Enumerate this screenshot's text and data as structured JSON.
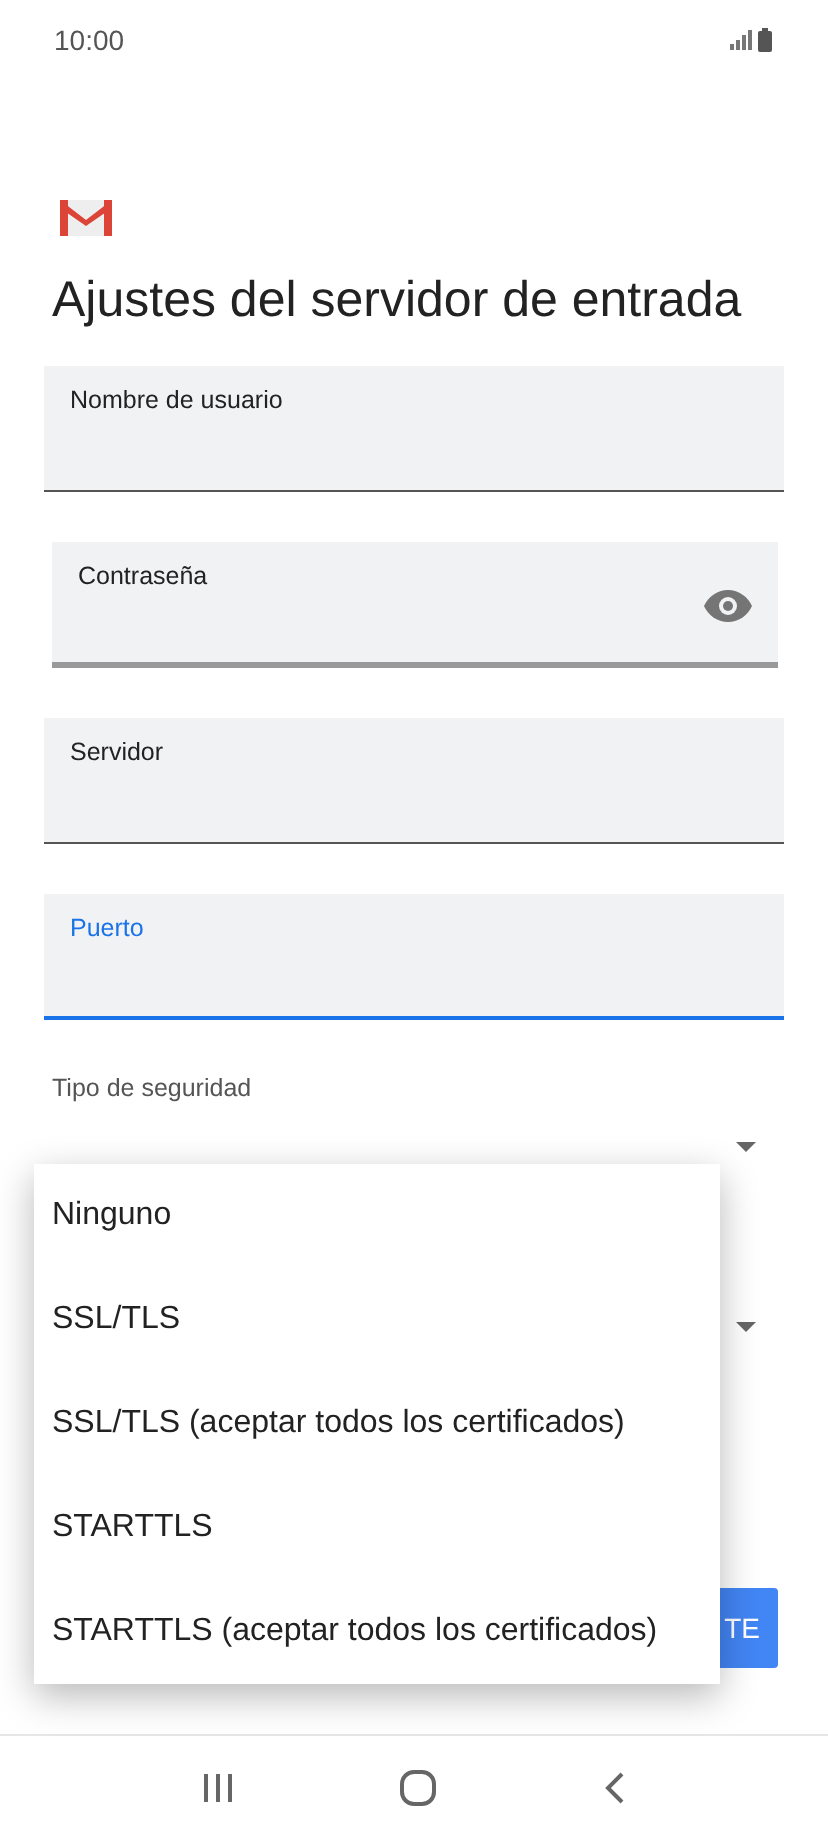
{
  "status_bar": {
    "time": "10:00"
  },
  "title": "Ajustes del servidor de entrada",
  "fields": [
    {
      "label": "Nombre de usuario",
      "kind": "text",
      "focused": false
    },
    {
      "label": "Contraseña",
      "kind": "password",
      "focused": false
    },
    {
      "label": "Servidor",
      "kind": "text",
      "focused": false
    },
    {
      "label": "Puerto",
      "kind": "text",
      "focused": true
    }
  ],
  "security": {
    "label": "Tipo de seguridad"
  },
  "menu": [
    {
      "label": "Ninguno",
      "selected": false
    },
    {
      "label": "SSL/TLS",
      "selected": false
    },
    {
      "label": "SSL/TLS (aceptar todos los certificados)",
      "selected": false
    },
    {
      "label": "STARTTLS",
      "selected": false
    },
    {
      "label": "STARTTLS (aceptar todos los certificados)",
      "selected": false
    }
  ],
  "next_button": "TE"
}
